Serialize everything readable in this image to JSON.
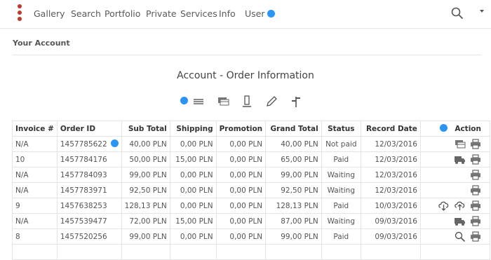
{
  "nav": {
    "items": [
      "Gallery",
      "Search",
      "Portfolio",
      "Private",
      "Services",
      "Info",
      "User"
    ]
  },
  "account_title": "Your Account",
  "heading": "Account - Order Information",
  "table": {
    "headers": [
      "Invoice #",
      "Order ID",
      "Sub Total",
      "Shipping",
      "Promotion",
      "Grand Total",
      "Status",
      "Record Date",
      "Action"
    ],
    "rows": [
      {
        "invoice": "N/A",
        "order_id": "1457785622",
        "sub": "40,00 PLN",
        "ship": "0,00 PLN",
        "promo": "0,00 PLN",
        "grand": "40,00 PLN",
        "status": "Not paid",
        "date": "12/03/2016",
        "actions": [
          "card-icon",
          "printer-icon"
        ]
      },
      {
        "invoice": "10",
        "order_id": "1457784176",
        "sub": "50,00 PLN",
        "ship": "15,00 PLN",
        "promo": "0,00 PLN",
        "grand": "65,00 PLN",
        "status": "Paid",
        "date": "12/03/2016",
        "actions": [
          "truck-icon",
          "printer-icon"
        ]
      },
      {
        "invoice": "N/A",
        "order_id": "1457784093",
        "sub": "99,00 PLN",
        "ship": "0,00 PLN",
        "promo": "0,00 PLN",
        "grand": "99,00 PLN",
        "status": "Waiting",
        "date": "12/03/2016",
        "actions": [
          "printer-icon"
        ]
      },
      {
        "invoice": "N/A",
        "order_id": "1457783971",
        "sub": "92,50 PLN",
        "ship": "0,00 PLN",
        "promo": "0,00 PLN",
        "grand": "92,50 PLN",
        "status": "Waiting",
        "date": "12/03/2016",
        "actions": [
          "printer-icon"
        ]
      },
      {
        "invoice": "9",
        "order_id": "1457638253",
        "sub": "128,13 PLN",
        "ship": "0,00 PLN",
        "promo": "0,00 PLN",
        "grand": "128,13 PLN",
        "status": "Paid",
        "date": "10/03/2016",
        "actions": [
          "cloud-download-icon",
          "cloud-upload-icon",
          "printer-icon"
        ]
      },
      {
        "invoice": "N/A",
        "order_id": "1457539477",
        "sub": "72,00 PLN",
        "ship": "15,00 PLN",
        "promo": "0,00 PLN",
        "grand": "87,00 PLN",
        "status": "Waiting",
        "date": "09/03/2016",
        "actions": [
          "truck-icon",
          "printer-icon"
        ]
      },
      {
        "invoice": "8",
        "order_id": "1457520256",
        "sub": "99,00 PLN",
        "ship": "0,00 PLN",
        "promo": "0,00 PLN",
        "grand": "99,00 PLN",
        "status": "Paid",
        "date": "09/03/2016",
        "actions": [
          "search-icon",
          "printer-icon"
        ]
      },
      {
        "invoice": "",
        "order_id": "",
        "sub": "",
        "ship": "",
        "promo": "",
        "grand": "",
        "status": "",
        "date": "",
        "actions": []
      }
    ]
  },
  "colors": {
    "accent": "#2b95f5",
    "logo": "#c0392b"
  }
}
